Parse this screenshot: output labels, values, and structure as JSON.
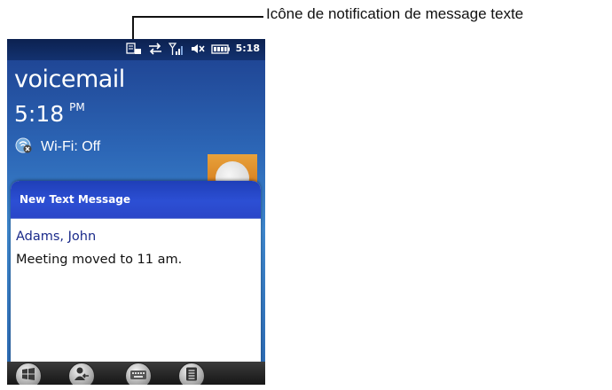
{
  "annotation": {
    "label": "Icône de notification de message texte"
  },
  "statusbar": {
    "time": "5:18",
    "icons": [
      "text-message-notification-icon",
      "data-connection-icon",
      "signal-strength-icon",
      "speaker-muted-icon",
      "battery-icon"
    ]
  },
  "today": {
    "title": "voicemail",
    "time": "5:18",
    "ampm": "PM",
    "wifi_status": "Wi-Fi: Off"
  },
  "notification": {
    "title": "New Text Message",
    "sender": "Adams, John",
    "message": "Meeting moved to 11 am."
  },
  "taskbar": {
    "buttons": [
      "start-icon",
      "contact-reply-icon",
      "keyboard-icon",
      "menu-icon"
    ]
  },
  "colors": {
    "popup_header": "#2c4fd4",
    "sender_text": "#1a2a8a",
    "today_accent": "#2c66b6"
  }
}
